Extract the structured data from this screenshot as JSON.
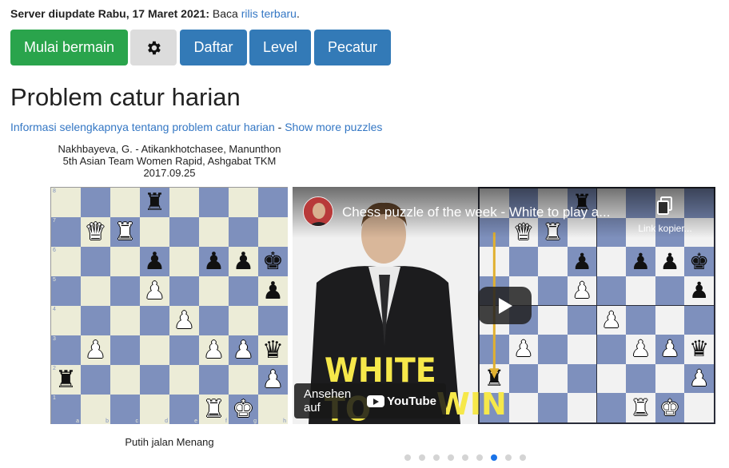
{
  "notice": {
    "bold": "Server diupdate Rabu, 17 Maret 2021:",
    "text": " Baca ",
    "link": "rilis terbaru",
    "end": "."
  },
  "buttons": {
    "play": "Mulai bermain",
    "settings_icon": "gear-icon",
    "register": "Daftar",
    "level": "Level",
    "players": "Pecatur"
  },
  "page_title": "Problem catur harian",
  "info": {
    "link1": "Informasi selengkapnya tentang problem catur harian",
    "sep": " - ",
    "link2": "Show more puzzles"
  },
  "puzzle": {
    "players": "Nakhbayeva, G. - Atikankhotchasee, Manunthon",
    "event": "5th Asian Team Women Rapid, Ashgabat TKM",
    "date": "2017.09.25",
    "footer": "Putih jalan Menang",
    "files": [
      "a",
      "b",
      "c",
      "d",
      "e",
      "f",
      "g",
      "h"
    ],
    "ranks": [
      "8",
      "7",
      "6",
      "5",
      "4",
      "3",
      "2",
      "1"
    ],
    "pieces": [
      {
        "sq": "d8",
        "p": "♜",
        "c": "b"
      },
      {
        "sq": "b7",
        "p": "♛",
        "c": "w"
      },
      {
        "sq": "c7",
        "p": "♜",
        "c": "w"
      },
      {
        "sq": "d6",
        "p": "♟",
        "c": "b"
      },
      {
        "sq": "f6",
        "p": "♟",
        "c": "b"
      },
      {
        "sq": "g6",
        "p": "♟",
        "c": "b"
      },
      {
        "sq": "h6",
        "p": "♚",
        "c": "b"
      },
      {
        "sq": "d5",
        "p": "♟",
        "c": "w"
      },
      {
        "sq": "h5",
        "p": "♟",
        "c": "b"
      },
      {
        "sq": "e4",
        "p": "♟",
        "c": "w"
      },
      {
        "sq": "b3",
        "p": "♟",
        "c": "w"
      },
      {
        "sq": "f3",
        "p": "♟",
        "c": "w"
      },
      {
        "sq": "g3",
        "p": "♟",
        "c": "w"
      },
      {
        "sq": "h3",
        "p": "♛",
        "c": "b"
      },
      {
        "sq": "a2",
        "p": "♜",
        "c": "b"
      },
      {
        "sq": "h2",
        "p": "♟",
        "c": "w"
      },
      {
        "sq": "f1",
        "p": "♜",
        "c": "w"
      },
      {
        "sq": "g1",
        "p": "♚",
        "c": "w"
      }
    ]
  },
  "video": {
    "title": "Chess puzzle of the week - White to play a...",
    "copy_label": "Link kopier...",
    "watch_on": "Ansehen auf",
    "yt_text": "YouTube",
    "banner1": "WHITE TO",
    "banner2": "WIN"
  },
  "carousel": {
    "count": 9,
    "active": 6
  }
}
